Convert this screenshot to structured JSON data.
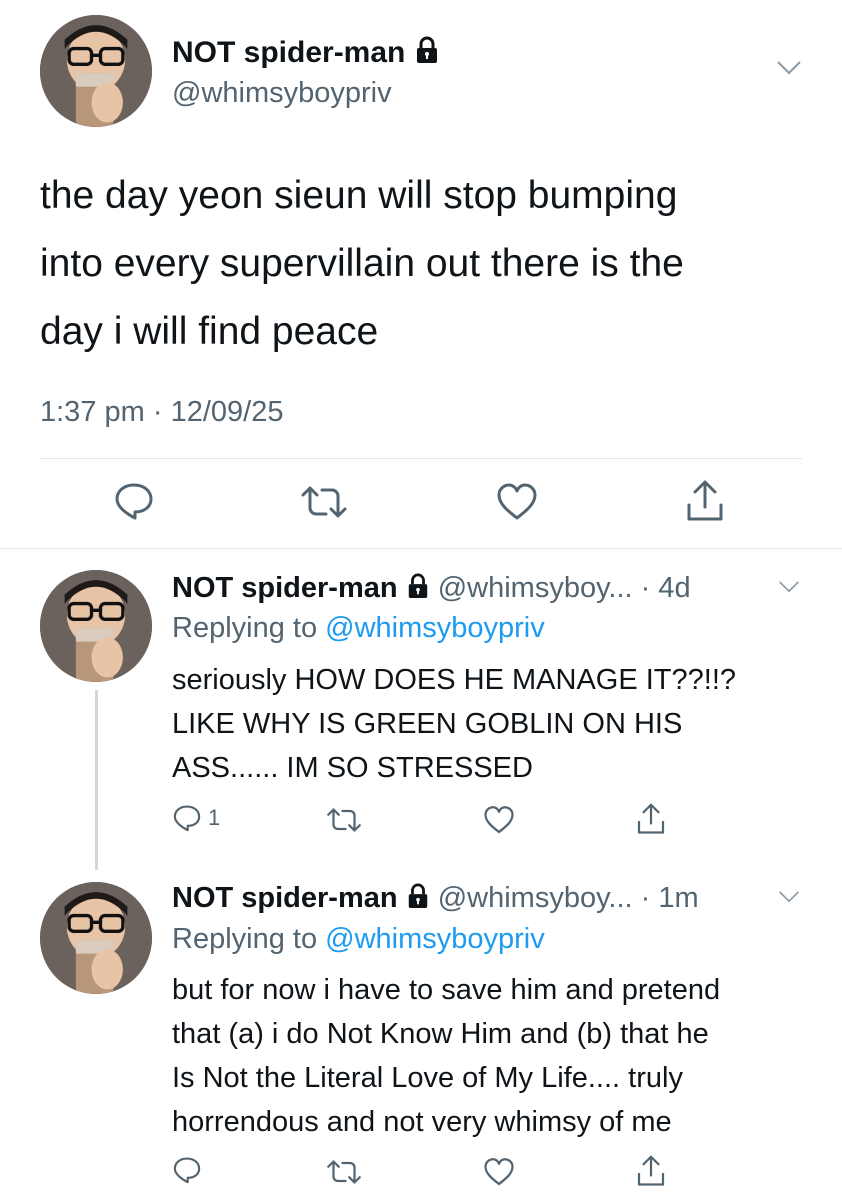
{
  "main_tweet": {
    "display_name": "NOT spider-man",
    "handle": "@whimsyboypriv",
    "text": "the day yeon sieun will stop bumping\ninto every supervillain out there is the\nday i will find peace",
    "time": "1:37 pm",
    "sep": "·",
    "date": "12/09/25",
    "icons": [
      "reply-icon",
      "retweet-icon",
      "like-icon",
      "share-icon"
    ]
  },
  "replies": [
    {
      "display_name": "NOT spider-man",
      "handle": "@whimsyboy...",
      "age": "· 4d",
      "replying_label": "Replying to",
      "replying_handle": "@whimsyboypriv",
      "text": "seriously HOW DOES HE MANAGE IT??!!?\nLIKE WHY IS GREEN GOBLIN ON HIS\nASS...... IM SO STRESSED",
      "reply_count": "1"
    },
    {
      "display_name": "NOT spider-man",
      "handle": "@whimsyboy...",
      "age": "· 1m",
      "replying_label": "Replying to",
      "replying_handle": "@whimsyboypriv",
      "text": "but for now i have to save him and pretend\nthat (a) i do Not Know Him and (b) that he\nIs Not the Literal Love of My Life.... truly\nhorrendous and not very whimsy of me",
      "reply_count": ""
    }
  ],
  "colors": {
    "text": "#0f1419",
    "muted": "#536471",
    "link": "#1d9bf0",
    "thread_line": "#cfd9de"
  }
}
